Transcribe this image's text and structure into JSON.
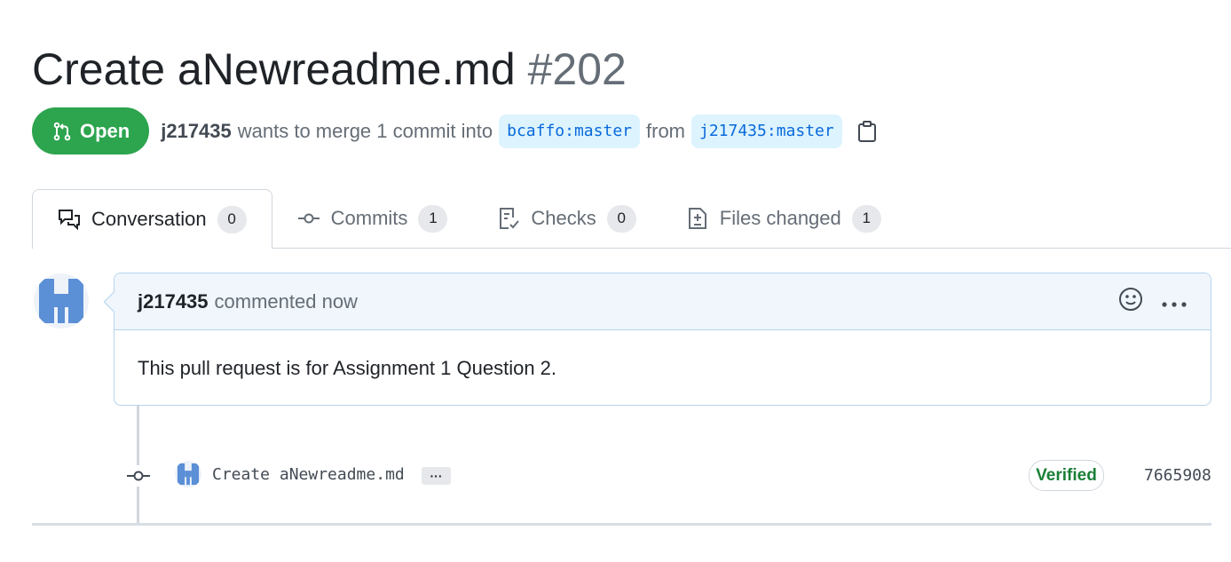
{
  "pull_request": {
    "title": "Create aNewreadme.md",
    "number": "#202",
    "state": "Open",
    "author": "j217435",
    "merge_text": "wants to merge 1 commit into",
    "base_branch": "bcaffo:master",
    "from_text": "from",
    "head_branch": "j217435:master"
  },
  "tabs": [
    {
      "label": "Conversation",
      "count": "0",
      "icon": "comment-discussion-icon",
      "selected": true
    },
    {
      "label": "Commits",
      "count": "1",
      "icon": "git-commit-icon",
      "selected": false
    },
    {
      "label": "Checks",
      "count": "0",
      "icon": "checklist-icon",
      "selected": false
    },
    {
      "label": "Files changed",
      "count": "1",
      "icon": "file-diff-icon",
      "selected": false
    }
  ],
  "comment": {
    "author": "j217435",
    "timestamp": "commented now",
    "body": "This pull request is for Assignment 1 Question 2."
  },
  "commit": {
    "message": "Create aNewreadme.md",
    "expand_label": "···",
    "badge": "Verified",
    "sha": "7665908"
  },
  "colors": {
    "open_green": "#2da44e",
    "verified_green": "#1a7f37",
    "branch_blue": "#0969da",
    "avatar_blue": "#5b8fd6"
  }
}
